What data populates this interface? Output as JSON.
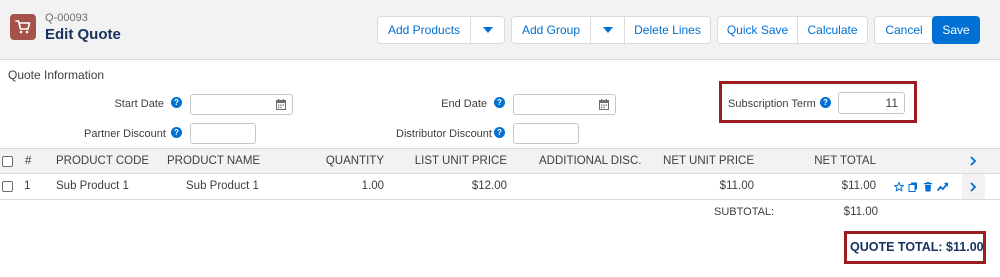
{
  "header": {
    "record_number": "Q-00093",
    "title": "Edit Quote",
    "icon": "cart-icon",
    "buttons": {
      "add_products": "Add Products",
      "add_group": "Add Group",
      "delete_lines": "Delete Lines",
      "quick_save": "Quick Save",
      "calculate": "Calculate",
      "cancel": "Cancel",
      "save": "Save"
    }
  },
  "quote_info": {
    "section_title": "Quote Information",
    "start_date_label": "Start Date",
    "start_date_value": "",
    "end_date_label": "End Date",
    "end_date_value": "",
    "subscription_term_label": "Subscription Term",
    "subscription_term_value": "11",
    "partner_discount_label": "Partner Discount",
    "partner_discount_value": "",
    "distributor_discount_label": "Distributor Discount",
    "distributor_discount_value": ""
  },
  "table": {
    "columns": {
      "num": "#",
      "product_code": "PRODUCT CODE",
      "product_name": "PRODUCT NAME",
      "quantity": "QUANTITY",
      "list_unit_price": "LIST UNIT PRICE",
      "additional_disc": "ADDITIONAL DISC.",
      "net_unit_price": "NET UNIT PRICE",
      "net_total": "NET TOTAL"
    },
    "rows": [
      {
        "num": "1",
        "product_code": "Sub Product 1",
        "product_name": "Sub Product 1",
        "quantity": "1.00",
        "list_unit_price": "$12.00",
        "additional_disc": "",
        "net_unit_price": "$11.00",
        "net_total": "$11.00"
      }
    ]
  },
  "totals": {
    "subtotal_label": "SUBTOTAL:",
    "subtotal_value": "$11.00",
    "quote_total_label": "QUOTE TOTAL: $11.00"
  },
  "colors": {
    "brand_blue": "#0070d2",
    "highlight_red": "#9b1b1e",
    "app_icon": "#a5524a"
  }
}
